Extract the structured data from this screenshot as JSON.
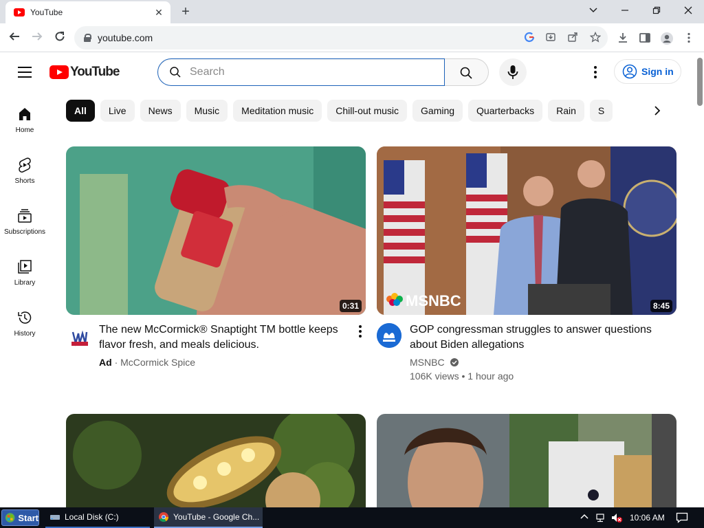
{
  "browser": {
    "tab_title": "YouTube",
    "url": "youtube.com"
  },
  "youtube": {
    "logo_text": "YouTube",
    "search_placeholder": "Search",
    "search_value": "",
    "signin_label": "Sign in",
    "accent_color": "#ff0000",
    "link_color": "#065fd4"
  },
  "guide": [
    {
      "label": "Home",
      "icon": "home-icon"
    },
    {
      "label": "Shorts",
      "icon": "shorts-icon"
    },
    {
      "label": "Subscriptions",
      "icon": "subscriptions-icon"
    },
    {
      "label": "Library",
      "icon": "library-icon"
    },
    {
      "label": "History",
      "icon": "history-icon"
    }
  ],
  "chips": [
    "All",
    "Live",
    "News",
    "Music",
    "Meditation music",
    "Chill-out music",
    "Gaming",
    "Quarterbacks",
    "Rain",
    "S"
  ],
  "videos": [
    {
      "title": "The new McCormick® Snaptight TM bottle keeps flavor fresh, and meals delicious.",
      "ad_label": "Ad",
      "channel": "McCormick Spice",
      "duration": "0:31"
    },
    {
      "title": "GOP congressman struggles to answer questions about Biden allegations",
      "channel": "MSNBC",
      "stats": "106K views • 1 hour ago",
      "duration": "8:45",
      "thumb_brand_text": "MSNBC"
    }
  ],
  "taskbar": {
    "start_label": "Start",
    "tasks": [
      "Local Disk (C:)",
      "YouTube - Google Ch..."
    ],
    "clock": "10:06 AM"
  }
}
